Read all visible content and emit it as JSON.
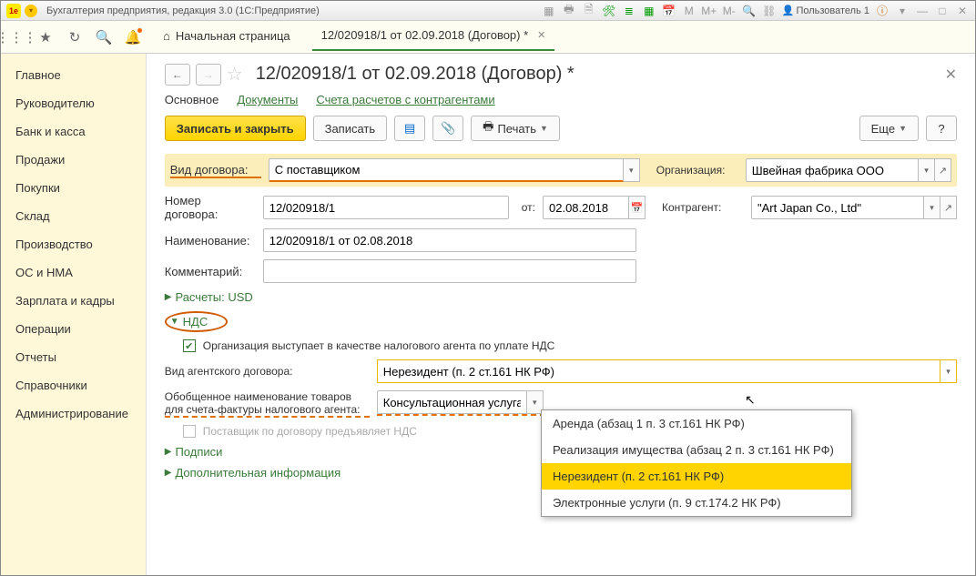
{
  "titlebar": {
    "app_title": "Бухгалтерия предприятия, редакция 3.0  (1С:Предприятие)",
    "user_label": "Пользователь 1"
  },
  "tabs": {
    "home": "Начальная страница",
    "doc": "12/020918/1 от 02.09.2018 (Договор) *"
  },
  "sidebar": {
    "items": [
      "Главное",
      "Руководителю",
      "Банк и касса",
      "Продажи",
      "Покупки",
      "Склад",
      "Производство",
      "ОС и НМА",
      "Зарплата и кадры",
      "Операции",
      "Отчеты",
      "Справочники",
      "Администрирование"
    ]
  },
  "doc": {
    "title": "12/020918/1 от 02.09.2018 (Договор) *",
    "main_tab": "Основное",
    "docs_tab": "Документы",
    "accounts_tab": "Счета расчетов с контрагентами",
    "write_close": "Записать и закрыть",
    "write": "Записать",
    "print": "Печать",
    "more": "Еще",
    "help": "?",
    "contract_type_label": "Вид договора:",
    "contract_type_value": "С поставщиком",
    "org_label": "Организация:",
    "org_value": "Швейная фабрика ООО",
    "num_label": "Номер договора:",
    "num_value": "12/020918/1",
    "from_label": "от:",
    "from_value": "02.08.2018",
    "counter_label": "Контрагент:",
    "counter_value": "\"Art Japan Co., Ltd\"",
    "name_label": "Наименование:",
    "name_value": "12/020918/1 от 02.08.2018",
    "comment_label": "Комментарий:",
    "calc_label": "Расчеты: USD",
    "nds_label": "НДС",
    "nds_check": "Организация выступает в качестве налогового агента по уплате НДС",
    "agent_type_label": "Вид агентского договора:",
    "agent_type_value": "Нерезидент (п. 2 ст.161 НК РФ)",
    "goods_label_1": "Обобщенное наименование товаров",
    "goods_label_2": "для счета-фактуры налогового агента:",
    "goods_value": "Консультационная услуга",
    "supplier_nds": "Поставщик по договору предъявляет НДС",
    "signatures": "Подписи",
    "addinfo": "Дополнительная информация"
  },
  "dropdown": {
    "items": [
      "Аренда (абзац 1 п. 3 ст.161 НК РФ)",
      "Реализация имущества (абзац 2 п. 3 ст.161 НК РФ)",
      "Нерезидент (п. 2 ст.161 НК РФ)",
      "Электронные услуги (п. 9 ст.174.2 НК РФ)"
    ]
  }
}
